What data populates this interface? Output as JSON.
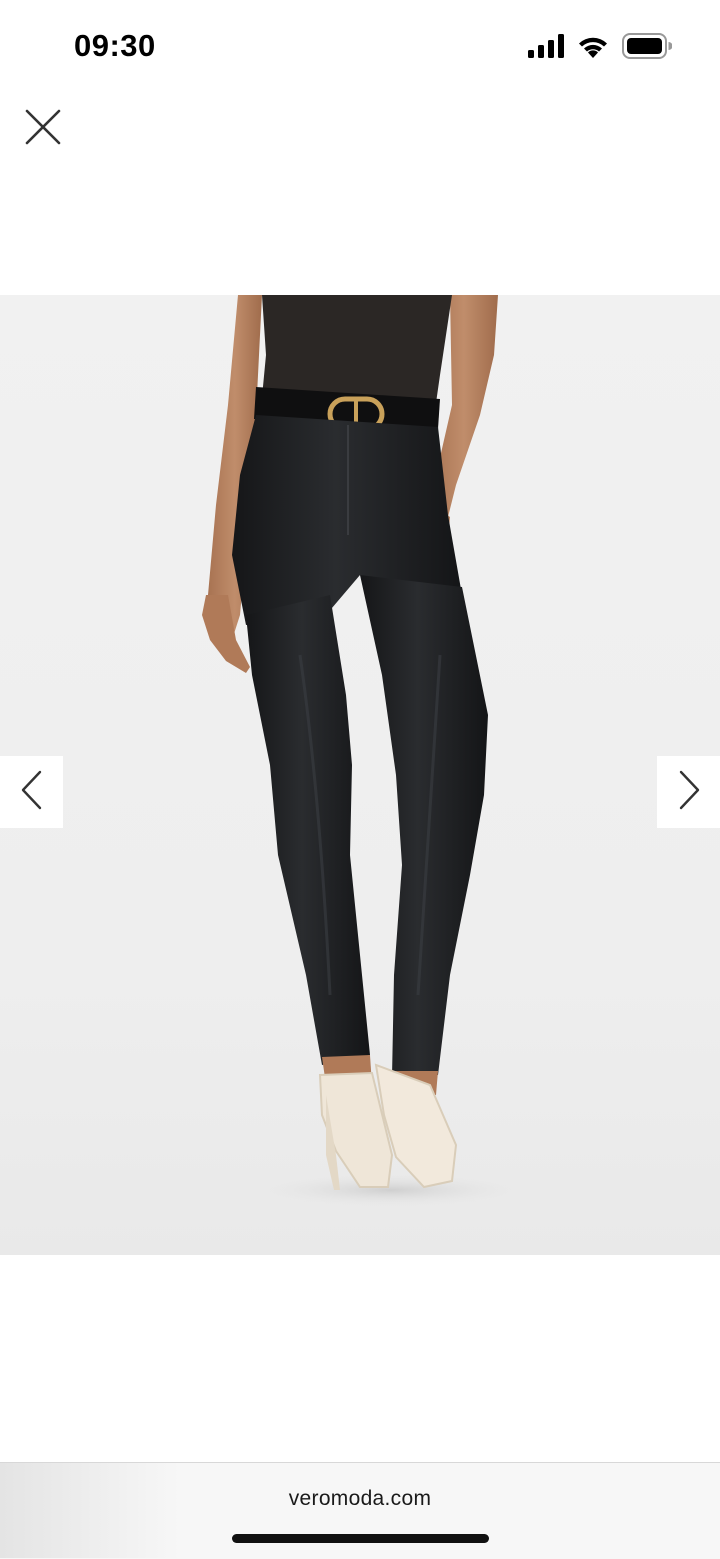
{
  "status_bar": {
    "time": "09:30",
    "icons": [
      "cellular-signal-icon",
      "wifi-icon",
      "battery-icon"
    ]
  },
  "viewer": {
    "close_icon": "close-icon",
    "image_alt": "Model wearing black coated skinny jeans with black belt and cream pumps",
    "prev_icon": "chevron-left-icon",
    "next_icon": "chevron-right-icon"
  },
  "browser_bar": {
    "domain": "veromoda.com"
  },
  "colors": {
    "background": "#ffffff",
    "photo_background": "#efefef",
    "jeans": "#1e1f21",
    "top": "#2a2624",
    "skin": "#b88461",
    "shoes": "#efe6d8",
    "buckle": "#c9a15a"
  }
}
